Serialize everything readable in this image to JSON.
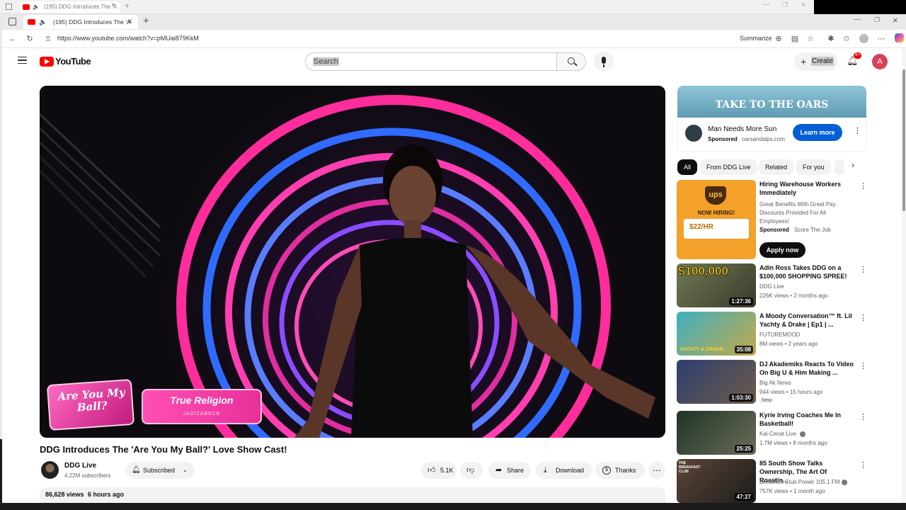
{
  "outer_window": {
    "tab_title": "(195) DDG Introduces The 'A"
  },
  "browser": {
    "tab_title": "(195) DDG Introduces The 'A",
    "url": "https://www.youtube.com/watch?v=pMUai879KkM",
    "summarize_label": "Summarize"
  },
  "yt": {
    "logo_text": "YouTube",
    "search_placeholder": "Search",
    "create_label": "Create",
    "notif_count": "9+",
    "avatar_letter": "A"
  },
  "video": {
    "overlay_left": "Are You My Ball?",
    "overlay_title": "True Religion",
    "overlay_handle": "JADIZABECK",
    "title": "DDG Introduces The 'Are You My Ball?' Love Show Cast!",
    "channel": "DDG Live",
    "subscribers": "4.22M subscribers",
    "subscribed_label": "Subscribed",
    "likes": "5.1K",
    "share_label": "Share",
    "download_label": "Download",
    "thanks_label": "Thanks",
    "views": "86,628 views",
    "age": "6 hours ago"
  },
  "ad": {
    "banner_text": "TAKE TO THE OARS",
    "title": "Man Needs More Sun",
    "sponsored": "Sponsored",
    "domain": "oarsandalps.com",
    "cta": "Learn more"
  },
  "chips": [
    "All",
    "From DDG Live",
    "Related",
    "For you"
  ],
  "sponsored_card": {
    "title": "Hiring Warehouse Workers Immediately",
    "desc": "Great Benefits With Great Pay. Discounts Provided For All Employees!",
    "sponsored": "Sponsored",
    "advertiser": "Score The Job",
    "cta": "Apply now",
    "thumb_brand": "ups",
    "thumb_heading": "NOW HIRING!",
    "thumb_pay": "$22/HR"
  },
  "recommendations": [
    {
      "title": "Adin Ross Takes DDG on a $100,000 SHOPPING SPREE!",
      "channel": "DDG Live",
      "meta": "226K views • 2 months ago",
      "duration": "1:27:36",
      "thumb_text": "$100,000",
      "badge": ""
    },
    {
      "title": "A Moody Conversation™ ft. Lil Yachty & Drake | Ep1 | ...",
      "channel": "FUTUREMOOD",
      "meta": "8M views • 2 years ago",
      "duration": "35:08",
      "thumb_text": "YACHTY & DRAKE",
      "badge": ""
    },
    {
      "title": "DJ Akademiks Reacts To Video On Big U & Him Making ...",
      "channel": "Big Ak News",
      "meta": "944 views • 15 hours ago",
      "duration": "1:03:30",
      "thumb_text": "",
      "badge": "New"
    },
    {
      "title": "Kyrie Irving Coaches Me In Basketball!",
      "channel": "Kai Cenat Live",
      "meta": "1.7M views • 8 months ago",
      "duration": "25:25",
      "thumb_text": "",
      "badge": ""
    },
    {
      "title": "85 South Show Talks Ownership, The Art Of Roastin...",
      "channel": "Breakfast Club Power 105.1 FM",
      "meta": "757K views • 1 month ago",
      "duration": "47:27",
      "thumb_text": "THE BREAKFAST CLUB",
      "badge": ""
    }
  ],
  "colors": {
    "yt_red": "#ff0000",
    "ad_blue": "#065fd4",
    "neon_pink": "#ff2d9b",
    "neon_blue": "#2f6bff"
  }
}
